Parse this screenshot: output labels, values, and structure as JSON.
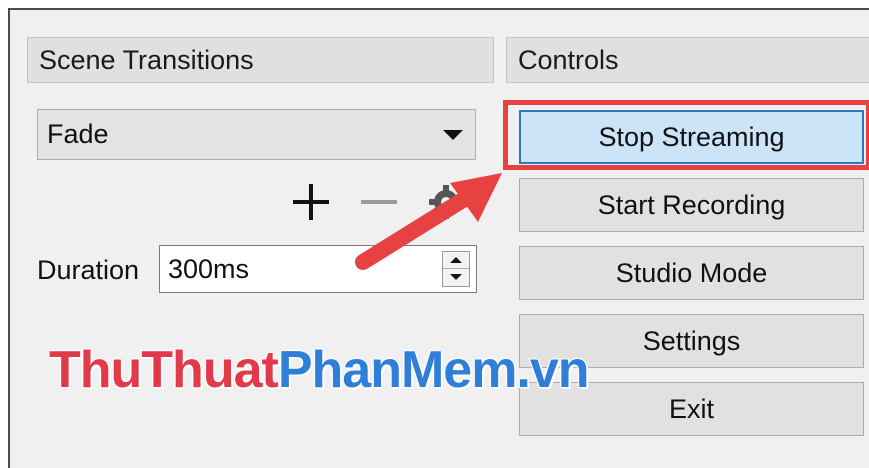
{
  "scene_transitions": {
    "title": "Scene Transitions",
    "transition_select": {
      "value": "Fade"
    },
    "duration": {
      "label": "Duration",
      "value": "300ms"
    }
  },
  "controls": {
    "title": "Controls",
    "buttons": [
      {
        "label": "Stop Streaming",
        "active": true
      },
      {
        "label": "Start Recording"
      },
      {
        "label": "Studio Mode"
      },
      {
        "label": "Settings"
      },
      {
        "label": "Exit"
      }
    ]
  },
  "watermark": {
    "part1": "ThuThuat",
    "part2": "PhanMem.vn",
    "color1": "#e23a4a",
    "color2": "#2f7fd8"
  },
  "annotation": {
    "color": "#e74141"
  },
  "icons": [
    "add-icon",
    "remove-icon",
    "gear-icon",
    "dropdown-arrow-icon",
    "spin-up-icon",
    "spin-down-icon"
  ]
}
